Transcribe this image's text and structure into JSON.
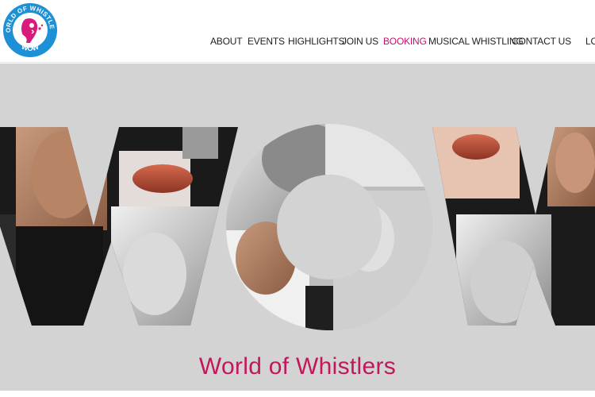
{
  "logo": {
    "ring_text_top": "WORLD OF WHISTLERS",
    "ring_text_bottom": "WOW",
    "ring_color": "#1e90d6",
    "mark_color": "#d81b7a",
    "icon": "whistling-face-icon"
  },
  "nav": {
    "items": [
      {
        "label": "ABOUT"
      },
      {
        "label": "EVENTS"
      },
      {
        "label": "HIGHLIGHTS"
      },
      {
        "label": "JOIN US"
      },
      {
        "label": "BOOKING",
        "active": true
      },
      {
        "label": "MUSICAL WHISTLING"
      },
      {
        "label": "CONTACT US"
      },
      {
        "label": "LO"
      }
    ],
    "active_color": "#cc0c6f",
    "text_color": "#222222"
  },
  "hero": {
    "background": "#d3d3d3",
    "big_letters": "WOW",
    "tagline": "World of Whistlers",
    "tagline_color": "#c2185b"
  }
}
